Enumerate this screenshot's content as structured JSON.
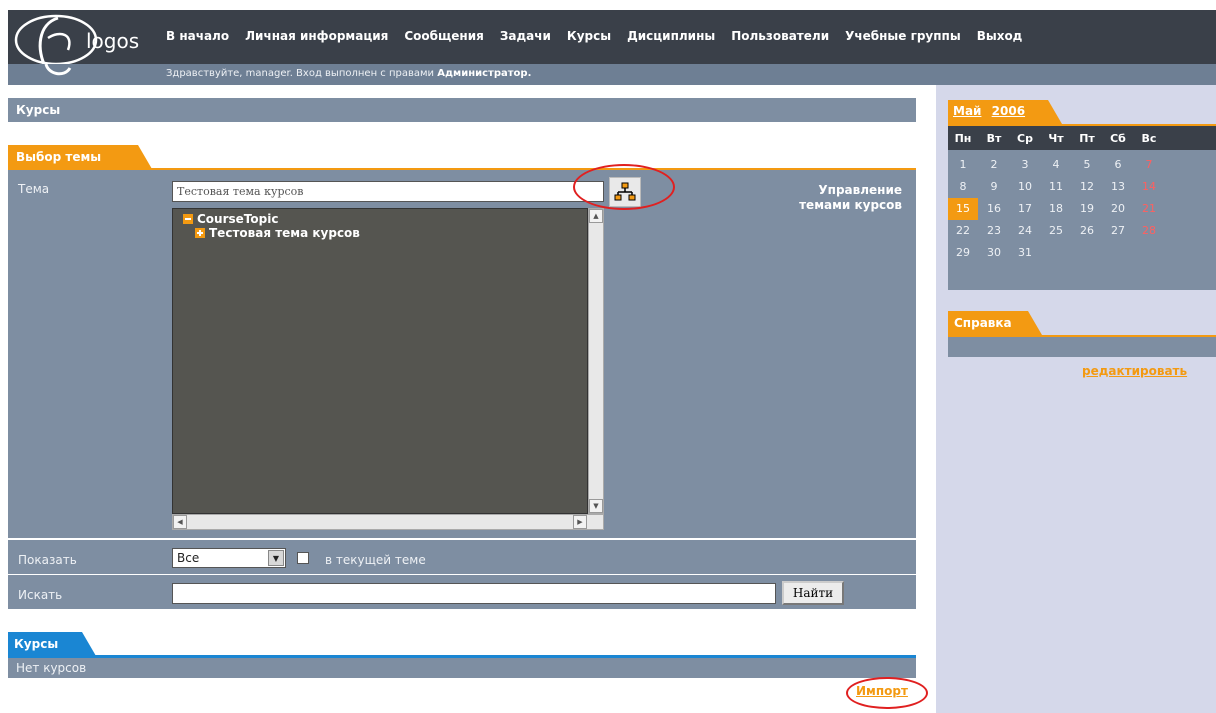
{
  "header": {
    "logo_text": "logos",
    "nav": [
      "В начало",
      "Личная информация",
      "Сообщения",
      "Задачи",
      "Курсы",
      "Дисциплины",
      "Пользователи",
      "Учебные группы",
      "Выход"
    ],
    "greeting_prefix": "Здравствуйте, manager.  Вход выполнен с правами ",
    "greeting_role": "Администратор."
  },
  "main": {
    "page_title": "Курсы",
    "select_section": {
      "tab": "Выбор темы",
      "theme_label": "Тема",
      "theme_value": "Тестовая тема курсов",
      "manage_label": "Управление темами курсов",
      "tree": {
        "root": "CourseTopic",
        "child": "Тестовая тема курсов"
      },
      "show_label": "Показать",
      "show_value": "Все",
      "current_theme_label": "в текущей теме",
      "search_label": "Искать",
      "search_value": "",
      "find_button": "Найти"
    },
    "courses_section": {
      "tab": "Курсы",
      "empty_text": "Нет курсов",
      "import_link": "Импорт"
    }
  },
  "sidebar": {
    "calendar": {
      "month": "Май",
      "year": "2006",
      "weekdays": [
        "Пн",
        "Вт",
        "Ср",
        "Чт",
        "Пт",
        "Сб",
        "Вс"
      ],
      "weeks": [
        [
          "1",
          "2",
          "3",
          "4",
          "5",
          "6",
          "7"
        ],
        [
          "8",
          "9",
          "10",
          "11",
          "12",
          "13",
          "14"
        ],
        [
          "15",
          "16",
          "17",
          "18",
          "19",
          "20",
          "21"
        ],
        [
          "22",
          "23",
          "24",
          "25",
          "26",
          "27",
          "28"
        ],
        [
          "29",
          "30",
          "31",
          "",
          "",
          "",
          ""
        ]
      ],
      "today": "15"
    },
    "help": {
      "tab": "Справка",
      "edit_link": "редактировать"
    }
  },
  "colors": {
    "accent": "#f39a12",
    "panel": "#7e8ea2",
    "header": "#3a4049",
    "courses_accent": "#1a86d3"
  }
}
